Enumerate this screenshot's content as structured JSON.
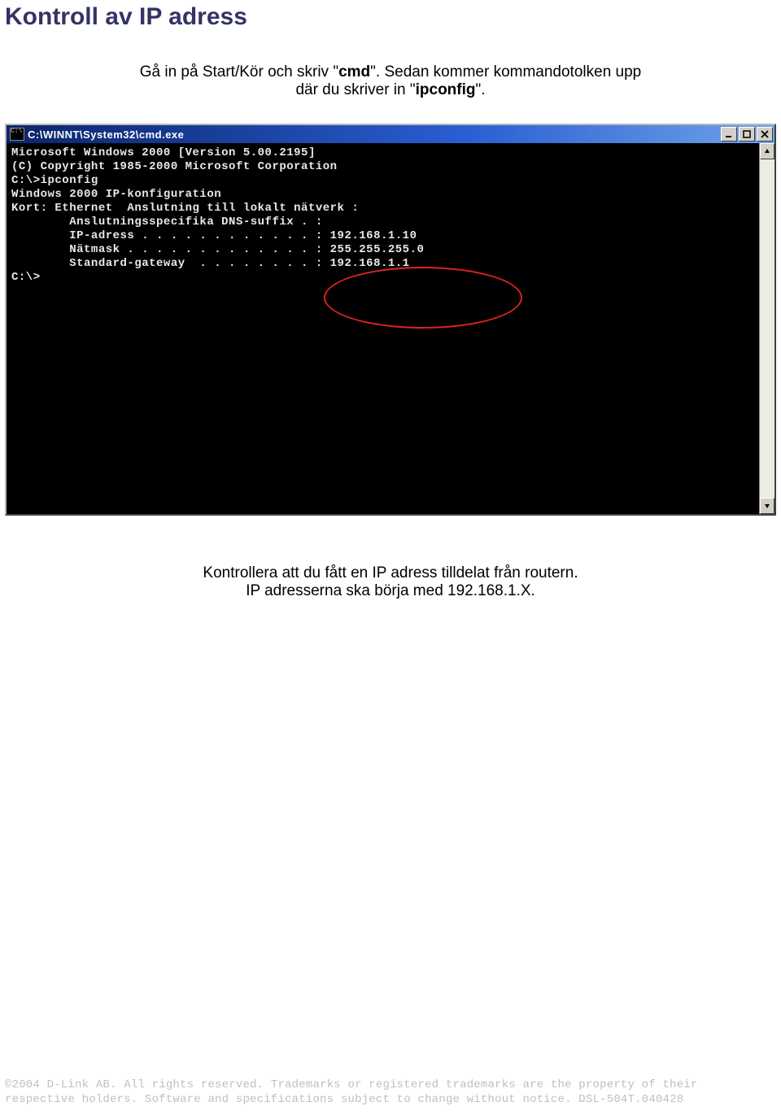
{
  "page_title": "Kontroll av IP adress",
  "instruction": {
    "line1_pre": "Gå in på Start/Kör och skriv \"",
    "line1_bold": "cmd",
    "line1_post": "\". Sedan kommer kommandotolken upp",
    "line2_pre": "där du skriver in \"",
    "line2_bold": "ipconfig",
    "line2_post": "\"."
  },
  "cmd": {
    "title": "C:\\WINNT\\System32\\cmd.exe",
    "lines": [
      "Microsoft Windows 2000 [Version 5.00.2195]",
      "(C) Copyright 1985-2000 Microsoft Corporation",
      "",
      "C:\\>ipconfig",
      "",
      "Windows 2000 IP-konfiguration",
      "",
      "Kort: Ethernet  Anslutning till lokalt nätverk :",
      "",
      "        Anslutningsspecifika DNS-suffix . :",
      "        IP-adress . . . . . . . . . . . . : 192.168.1.10",
      "        Nätmask . . . . . . . . . . . . . : 255.255.255.0",
      "        Standard-gateway  . . . . . . . . : 192.168.1.1",
      "",
      "C:\\>"
    ],
    "ipconfig_values": {
      "dns_suffix": "",
      "ip_address": "192.168.1.10",
      "netmask": "255.255.255.0",
      "default_gateway": "192.168.1.1"
    }
  },
  "mid": {
    "line1": "Kontrollera att du fått en IP adress tilldelat från routern.",
    "line2": "IP adresserna ska börja med 192.168.1.X."
  },
  "footer": {
    "line1": "©2004 D-Link AB. All rights reserved. Trademarks or registered trademarks are the property of their",
    "line2": "respective holders. Software and specifications subject to change without notice. DSL-504T.040428"
  }
}
